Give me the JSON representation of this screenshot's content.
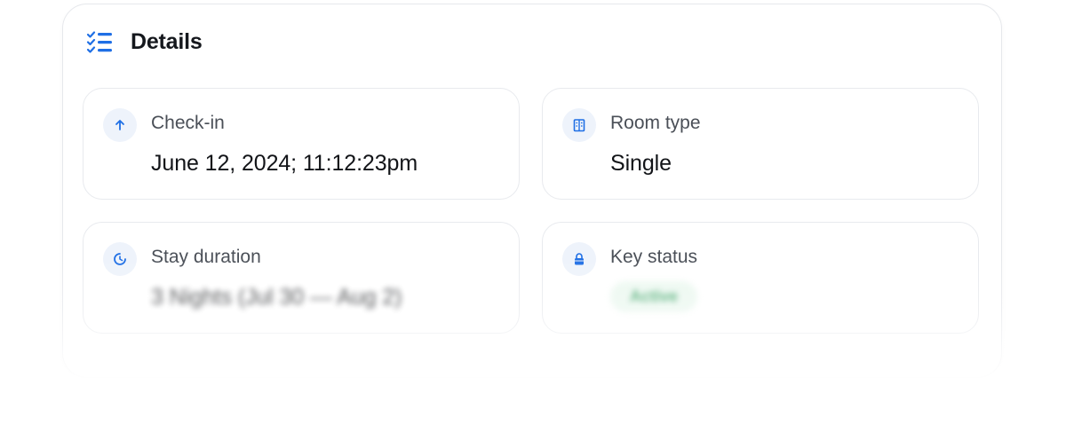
{
  "header": {
    "title": "Details",
    "icon": "checklist-icon",
    "accent_color": "#1f6fe5"
  },
  "cards": {
    "checkin": {
      "icon": "arrow-up-icon",
      "label": "Check-in",
      "value": "June 12, 2024; 11:12:23pm"
    },
    "room_type": {
      "icon": "building-icon",
      "label": "Room type",
      "value": "Single"
    },
    "stay_duration": {
      "icon": "pie-timer-icon",
      "label": "Stay duration",
      "value": "3 Nights (Jul 30 — Aug 2)"
    },
    "key_status": {
      "icon": "lock-icon",
      "label": "Key status",
      "badge": "Active",
      "badge_color": "#2f9d5b"
    }
  }
}
